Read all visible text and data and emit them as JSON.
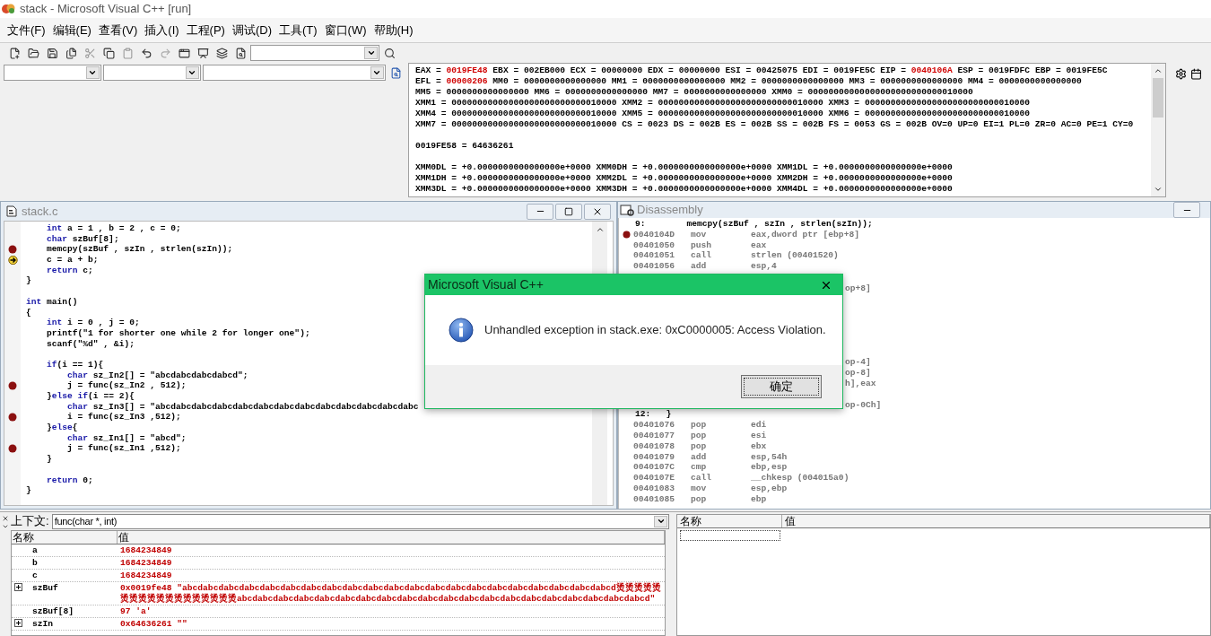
{
  "window": {
    "title": "stack - Microsoft Visual C++ [run]"
  },
  "menu": [
    "文件(F)",
    "编辑(E)",
    "查看(V)",
    "插入(I)",
    "工程(P)",
    "调试(D)",
    "工具(T)",
    "窗口(W)",
    "帮助(H)"
  ],
  "registers": {
    "lines": [
      {
        "kind": "text",
        "text": "EAX = **0019FE48** EBX = 002EB000 ECX = 00000000 EDX = 00000000 ESI = 00425075 EDI = 0019FE5C EIP = **0040106A** ESP = 0019FDFC EBP = 0019FE5C"
      },
      {
        "kind": "text",
        "text": "EFL = **00000206** MM0 = 0000000000000000 MM1 = 0000000000000000 MM2 = 0000000000000000 MM3 = 0000000000000000 MM4 = 0000000000000000"
      },
      {
        "kind": "text",
        "text": "MM5 = 0000000000000000 MM6 = 0000000000000000 MM7 = 0000000000000000 XMM0 = 00000000000000000000000000010000"
      },
      {
        "kind": "text",
        "text": "XMM1 = 00000000000000000000000000010000 XMM2 = 00000000000000000000000000010000 XMM3 = 00000000000000000000000000010000"
      },
      {
        "kind": "text",
        "text": "XMM4 = 00000000000000000000000000010000 XMM5 = 00000000000000000000000000010000 XMM6 = 00000000000000000000000000010000"
      },
      {
        "kind": "text",
        "text": "XMM7 = 00000000000000000000000000010000 CS = 0023 DS = 002B ES = 002B SS = 002B FS = 0053 GS = 002B OV=0 UP=0 EI=1 PL=0 ZR=0 AC=0 PE=1 CY=0"
      },
      {
        "kind": "blank"
      },
      {
        "kind": "text",
        "text": "0019FE58 = 64636261"
      },
      {
        "kind": "blank"
      },
      {
        "kind": "text",
        "text": "XMM0DL = +0.0000000000000000e+0000 XMM0DH = +0.0000000000000000e+0000 XMM1DL = +0.0000000000000000e+0000"
      },
      {
        "kind": "text",
        "text": "XMM1DH = +0.0000000000000000e+0000 XMM2DL = +0.0000000000000000e+0000 XMM2DH = +0.0000000000000000e+0000"
      },
      {
        "kind": "text",
        "text": "XMM3DL = +0.0000000000000000e+0000 XMM3DH = +0.0000000000000000e+0000 XMM4DL = +0.0000000000000000e+0000"
      }
    ]
  },
  "editor": {
    "title": "stack.c",
    "lines": [
      {
        "kind": "code",
        "breakpoint": false,
        "current": false,
        "text": "    **int** a = 1 , b = 2 , c = 0;"
      },
      {
        "kind": "code",
        "breakpoint": false,
        "current": false,
        "text": "    **char** szBuf[8];"
      },
      {
        "kind": "code",
        "breakpoint": true,
        "current": false,
        "text": "    memcpy(szBuf , szIn , strlen(szIn));"
      },
      {
        "kind": "code",
        "breakpoint": false,
        "current": true,
        "text": "    c = a + b;"
      },
      {
        "kind": "code",
        "breakpoint": false,
        "current": false,
        "text": "    **return** c;"
      },
      {
        "kind": "code",
        "breakpoint": false,
        "current": false,
        "text": "}"
      },
      {
        "kind": "blank"
      },
      {
        "kind": "code",
        "breakpoint": false,
        "current": false,
        "text": "**int** main()"
      },
      {
        "kind": "code",
        "breakpoint": false,
        "current": false,
        "text": "{"
      },
      {
        "kind": "code",
        "breakpoint": false,
        "current": false,
        "text": "    **int** i = 0 , j = 0;"
      },
      {
        "kind": "code",
        "breakpoint": false,
        "current": false,
        "text": "    printf(\"1 for shorter one while 2 for longer one\");"
      },
      {
        "kind": "code",
        "breakpoint": false,
        "current": false,
        "text": "    scanf(\"%d\" , &i);"
      },
      {
        "kind": "blank"
      },
      {
        "kind": "code",
        "breakpoint": false,
        "current": false,
        "text": "    **if**(i == 1){"
      },
      {
        "kind": "code",
        "breakpoint": false,
        "current": false,
        "text": "        **char** sz_In2[] = \"abcdabcdabcdabcd\";"
      },
      {
        "kind": "code",
        "breakpoint": true,
        "current": false,
        "text": "        j = func(sz_In2 , 512);"
      },
      {
        "kind": "code",
        "breakpoint": false,
        "current": false,
        "text": "    }**else** **if**(i == 2){"
      },
      {
        "kind": "code",
        "breakpoint": false,
        "current": false,
        "text": "        **char** sz_In3[] = \"abcdabcdabcdabcdabcdabcdabcdabcdabcdabcdabcdabcdabc"
      },
      {
        "kind": "code",
        "breakpoint": true,
        "current": false,
        "text": "        i = func(sz_In3 ,512);"
      },
      {
        "kind": "code",
        "breakpoint": false,
        "current": false,
        "text": "    }**else**{"
      },
      {
        "kind": "code",
        "breakpoint": false,
        "current": false,
        "text": "        **char** sz_In1[] = \"abcd\";"
      },
      {
        "kind": "code",
        "breakpoint": true,
        "current": false,
        "text": "        j = func(sz_In1 ,512);"
      },
      {
        "kind": "code",
        "breakpoint": false,
        "current": false,
        "text": "    }"
      },
      {
        "kind": "blank"
      },
      {
        "kind": "code",
        "breakpoint": false,
        "current": false,
        "text": "    **return** 0;"
      },
      {
        "kind": "code",
        "breakpoint": false,
        "current": false,
        "text": "}"
      }
    ]
  },
  "disassembly": {
    "title": "Disassembly",
    "rows": [
      {
        "kind": "source",
        "text": "9:        memcpy(szBuf , szIn , strlen(szIn));"
      },
      {
        "kind": "instr",
        "breakpoint": true,
        "address": "0040104D",
        "op": "mov",
        "args": "eax,dword ptr [ebp+8]"
      },
      {
        "kind": "instr",
        "breakpoint": false,
        "address": "00401050",
        "op": "push",
        "args": "eax"
      },
      {
        "kind": "instr",
        "breakpoint": false,
        "address": "00401051",
        "op": "call",
        "args": "strlen (00401520)"
      },
      {
        "kind": "instr",
        "breakpoint": false,
        "address": "00401056",
        "op": "add",
        "args": "esp,4"
      },
      {
        "kind": "hidden"
      },
      {
        "kind": "partial",
        "text": "op+8]"
      },
      {
        "kind": "hidden"
      },
      {
        "kind": "hidden"
      },
      {
        "kind": "hidden"
      },
      {
        "kind": "hidden"
      },
      {
        "kind": "hidden"
      },
      {
        "kind": "hidden"
      },
      {
        "kind": "partial",
        "text": "op-4]"
      },
      {
        "kind": "partial",
        "text": "op-8]"
      },
      {
        "kind": "partial",
        "text": "h],eax"
      },
      {
        "kind": "hidden"
      },
      {
        "kind": "partial",
        "text": "op-0Ch]"
      },
      {
        "kind": "source",
        "text": "12:   }"
      },
      {
        "kind": "instr",
        "breakpoint": false,
        "address": "00401076",
        "op": "pop",
        "args": "edi"
      },
      {
        "kind": "instr",
        "breakpoint": false,
        "address": "00401077",
        "op": "pop",
        "args": "esi"
      },
      {
        "kind": "instr",
        "breakpoint": false,
        "address": "00401078",
        "op": "pop",
        "args": "ebx"
      },
      {
        "kind": "instr",
        "breakpoint": false,
        "address": "00401079",
        "op": "add",
        "args": "esp,54h"
      },
      {
        "kind": "instr",
        "breakpoint": false,
        "address": "0040107C",
        "op": "cmp",
        "args": "ebp,esp"
      },
      {
        "kind": "instr",
        "breakpoint": false,
        "address": "0040107E",
        "op": "call",
        "args": "__chkesp (004015a0)"
      },
      {
        "kind": "instr",
        "breakpoint": false,
        "address": "00401083",
        "op": "mov",
        "args": "esp,ebp"
      },
      {
        "kind": "instr",
        "breakpoint": false,
        "address": "00401085",
        "op": "pop",
        "args": "ebp"
      }
    ]
  },
  "variables": {
    "context_label": "上下文:",
    "context": "func(char *, int)",
    "columns": [
      "名称",
      "值"
    ],
    "rows": [
      {
        "name": "a",
        "value": "1684234849",
        "expandable": false
      },
      {
        "name": "b",
        "value": "1684234849",
        "expandable": false
      },
      {
        "name": "c",
        "value": "1684234849",
        "expandable": false
      },
      {
        "name": "szBuf",
        "value": "0x0019fe48 \"abcdabcdabcdabcdabcdabcdabcdabcdabcdabcdabcdabcdabcdabcdabcdabcdabcdabcdabcdabcdabcd烫烫烫烫烫烫烫烫烫烫烫烫烫烫烫烫烫烫abcdabcdabcdabcdabcdabcdabcdabcdabcdabcdabcdabcdabcdabcdabcdabcdabcdabcdabcdabcd\"",
        "expandable": true
      },
      {
        "name": "szBuf[8]",
        "value": "97 'a'",
        "expandable": false
      },
      {
        "name": "szIn",
        "value": "0x64636261 \"\"",
        "expandable": true
      }
    ]
  },
  "watch": {
    "columns": [
      "名称",
      "值"
    ]
  },
  "dialog": {
    "title": "Microsoft Visual C++",
    "message": "Unhandled exception in stack.exe: 0xC0000005: Access Violation.",
    "button": "确定"
  }
}
